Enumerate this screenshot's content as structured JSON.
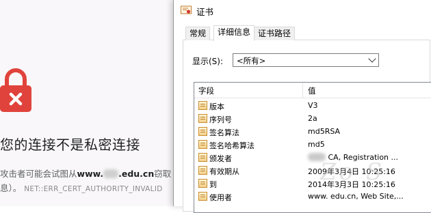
{
  "error_page": {
    "title": "您的连接不是私密连接",
    "desc_prefix": "攻击者可能会试图从",
    "host_prefix": "www.",
    "host_suffix": ".edu.cn",
    "desc_suffix": "窃取",
    "line2_prefix": "息）。",
    "error_code": "NET::ERR_CERT_AUTHORITY_INVALID"
  },
  "dialog": {
    "title": "证书",
    "tabs": [
      "常规",
      "详细信息",
      "证书路径"
    ],
    "active_tab": "详细信息",
    "show_label": "显示(S):",
    "show_value": "<所有>",
    "columns": {
      "field": "字段",
      "value": "值"
    },
    "rows": [
      {
        "field": "版本",
        "value": "V3"
      },
      {
        "field": "序列号",
        "value": "2a"
      },
      {
        "field": "签名算法",
        "value": "md5RSA"
      },
      {
        "field": "签名哈希算法",
        "value": "md5"
      },
      {
        "field": "颁发者",
        "value": "CA, Registration ..."
      },
      {
        "field": "有效期从",
        "value": "2009年3月4日 10:25:16"
      },
      {
        "field": "到",
        "value": "2014年3月3日 10:25:16"
      },
      {
        "field": "使用者",
        "value": "www.  edu.cn, Web Site,..."
      }
    ]
  },
  "colors": {
    "lock": "#e0433c",
    "page_bg": "#f9f7f9"
  }
}
